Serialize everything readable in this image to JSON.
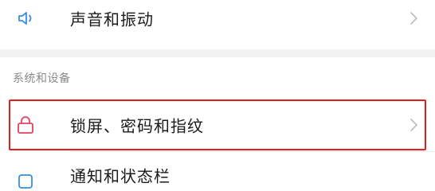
{
  "settings": {
    "rows": [
      {
        "label": "声音和振动",
        "icon": "speaker-icon",
        "icon_color": "#3b8de0"
      },
      {
        "label": "锁屏、密码和指纹",
        "icon": "lock-icon",
        "icon_color": "#e5415e",
        "highlighted": true
      },
      {
        "label": "通知和状态栏",
        "icon": "notification-icon",
        "icon_color": "#3b8de0",
        "partially_visible": true
      }
    ],
    "section_header": "系统和设备"
  },
  "colors": {
    "highlight_border": "#e0201d",
    "chevron": "#bdbdbd",
    "section_gap": "#f2f2f2"
  }
}
